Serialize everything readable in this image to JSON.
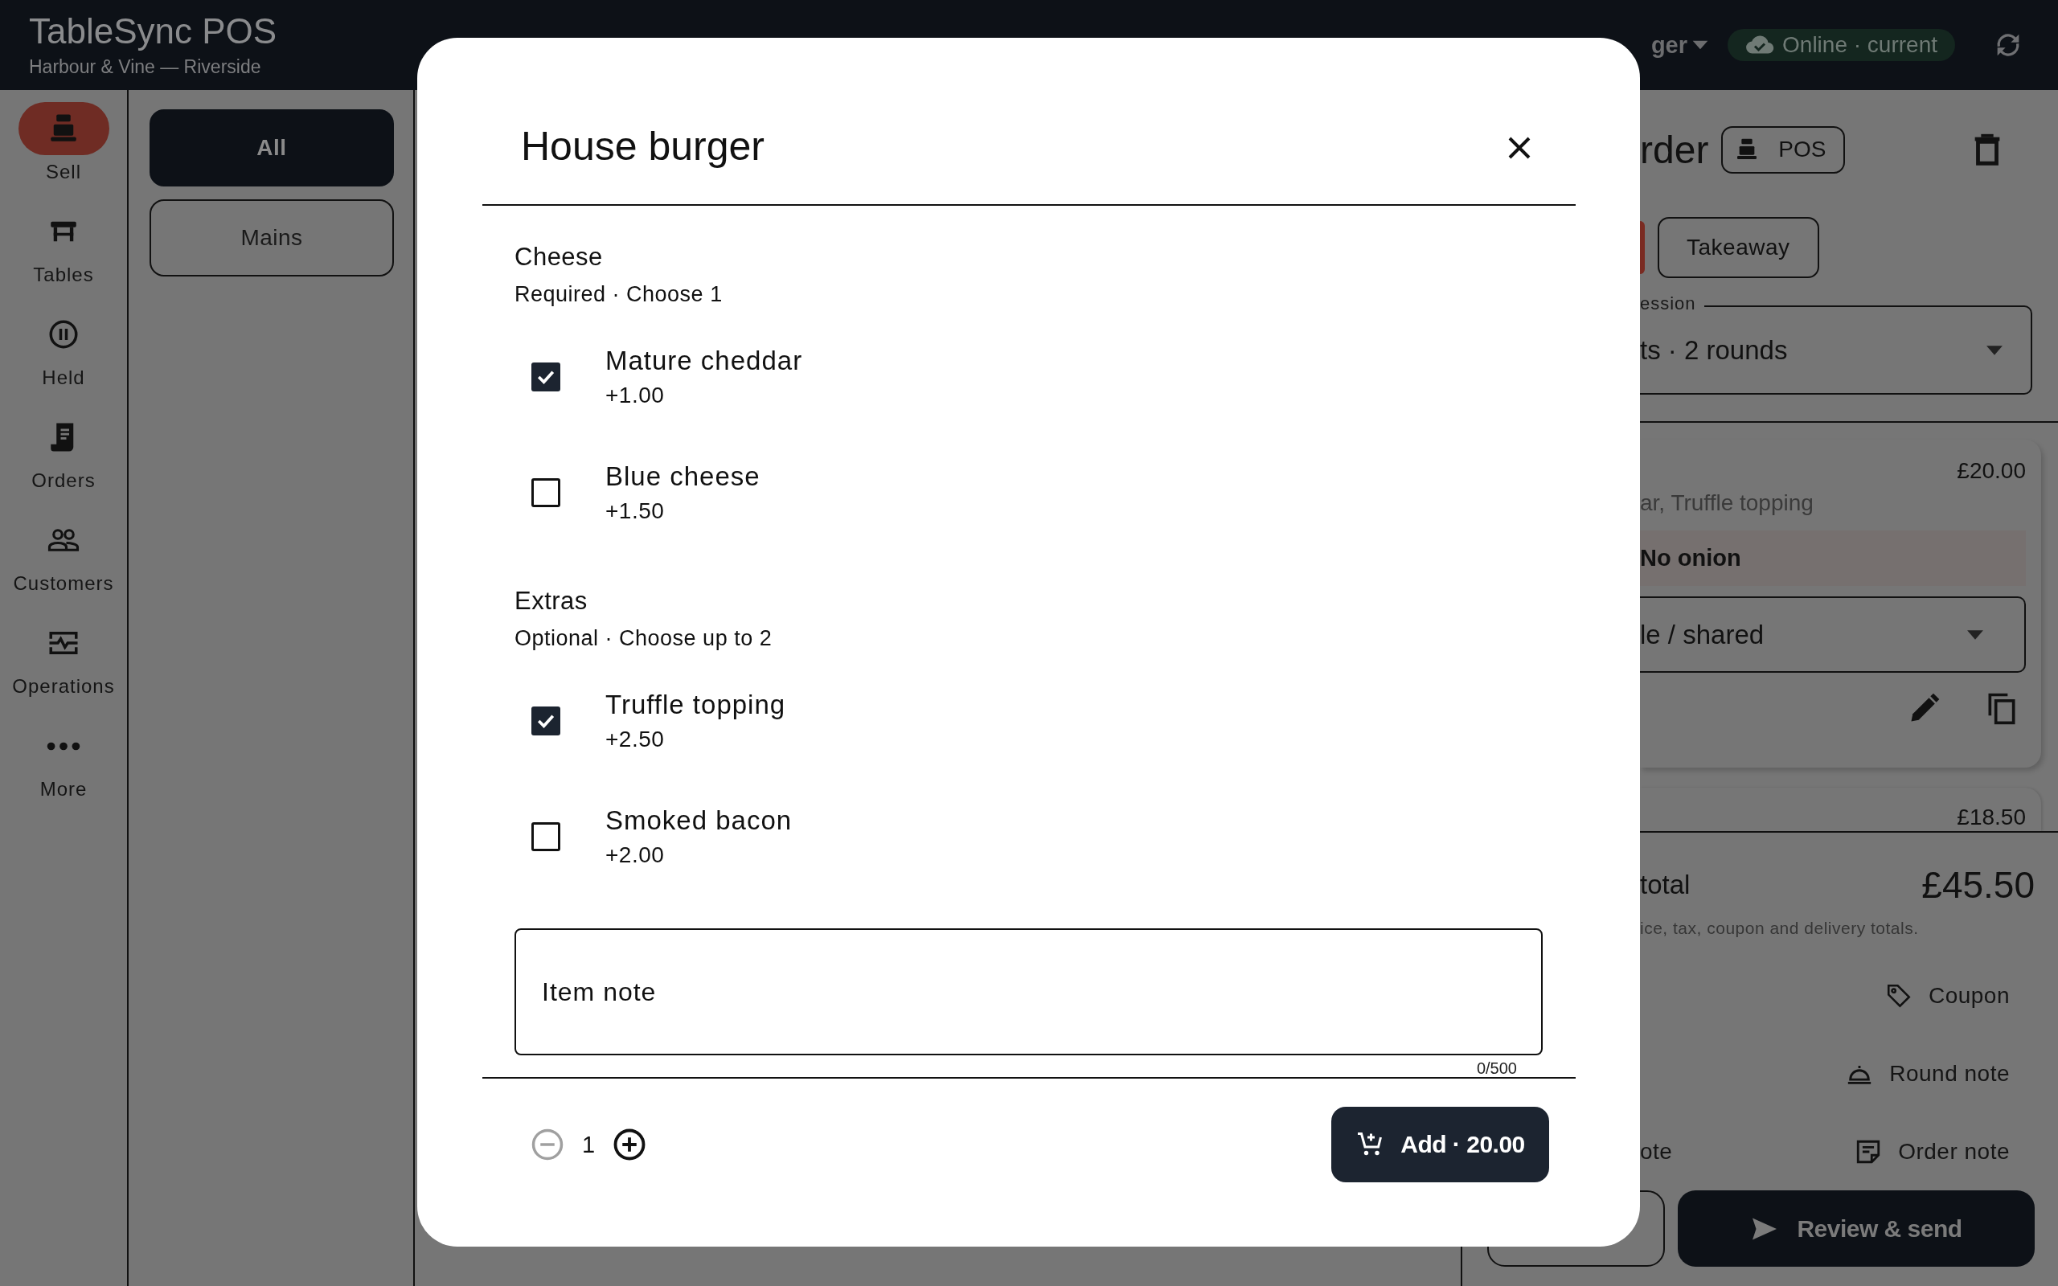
{
  "app": {
    "title": "TableSync POS",
    "subtitle": "Harbour & Vine — Riverside",
    "user_menu": "ger",
    "status": "Online · current"
  },
  "nav": [
    {
      "label": "Sell",
      "kind": "register",
      "selected": true
    },
    {
      "label": "Tables",
      "kind": "table",
      "selected": false
    },
    {
      "label": "Held",
      "kind": "pause",
      "selected": false
    },
    {
      "label": "Orders",
      "kind": "receipt",
      "selected": false
    },
    {
      "label": "Customers",
      "kind": "people",
      "selected": false
    },
    {
      "label": "Operations",
      "kind": "monitor",
      "selected": false
    },
    {
      "label": "More",
      "kind": "dots",
      "selected": false
    }
  ],
  "categories": [
    {
      "label": "All",
      "selected": true
    },
    {
      "label": "Mains",
      "selected": false
    }
  ],
  "order_panel": {
    "title": "rder",
    "source_chip": "POS",
    "service_types": [
      {
        "selected": true
      },
      {
        "label": "Takeaway",
        "selected": false
      }
    ],
    "session_select": {
      "label": "ession",
      "value": "ts · 2 rounds"
    },
    "lines": [
      {
        "price": "£20.00",
        "modifiers": "ar, Truffle topping",
        "note": "No onion",
        "assignment": "le / shared"
      },
      {
        "price": "£18.50"
      }
    ],
    "subtotal_label": "total",
    "subtotal": "£45.50",
    "hint": "ice, tax, coupon and delivery totals.",
    "action_rows": [
      {
        "right": {
          "label": "Coupon",
          "kind": "tag"
        }
      },
      {
        "right": {
          "label": "Round note",
          "kind": "bell"
        }
      },
      {
        "left": "ote",
        "right": {
          "label": "Order note",
          "kind": "note"
        }
      }
    ],
    "send_button": "Review & send"
  },
  "modal": {
    "title": "House burger",
    "groups": [
      {
        "name": "Cheese",
        "rule": "Required · Choose 1",
        "options": [
          {
            "name": "Mature cheddar",
            "price": "+1.00",
            "checked": true
          },
          {
            "name": "Blue cheese",
            "price": "+1.50",
            "checked": false
          }
        ]
      },
      {
        "name": "Extras",
        "rule": "Optional · Choose up to 2",
        "options": [
          {
            "name": "Truffle topping",
            "price": "+2.50",
            "checked": true
          },
          {
            "name": "Smoked bacon",
            "price": "+2.00",
            "checked": false
          }
        ]
      }
    ],
    "note": {
      "placeholder": "Item note",
      "counter": "0/500"
    },
    "quantity": "1",
    "decrease_disabled": true,
    "add_button": "Add · 20.00"
  }
}
